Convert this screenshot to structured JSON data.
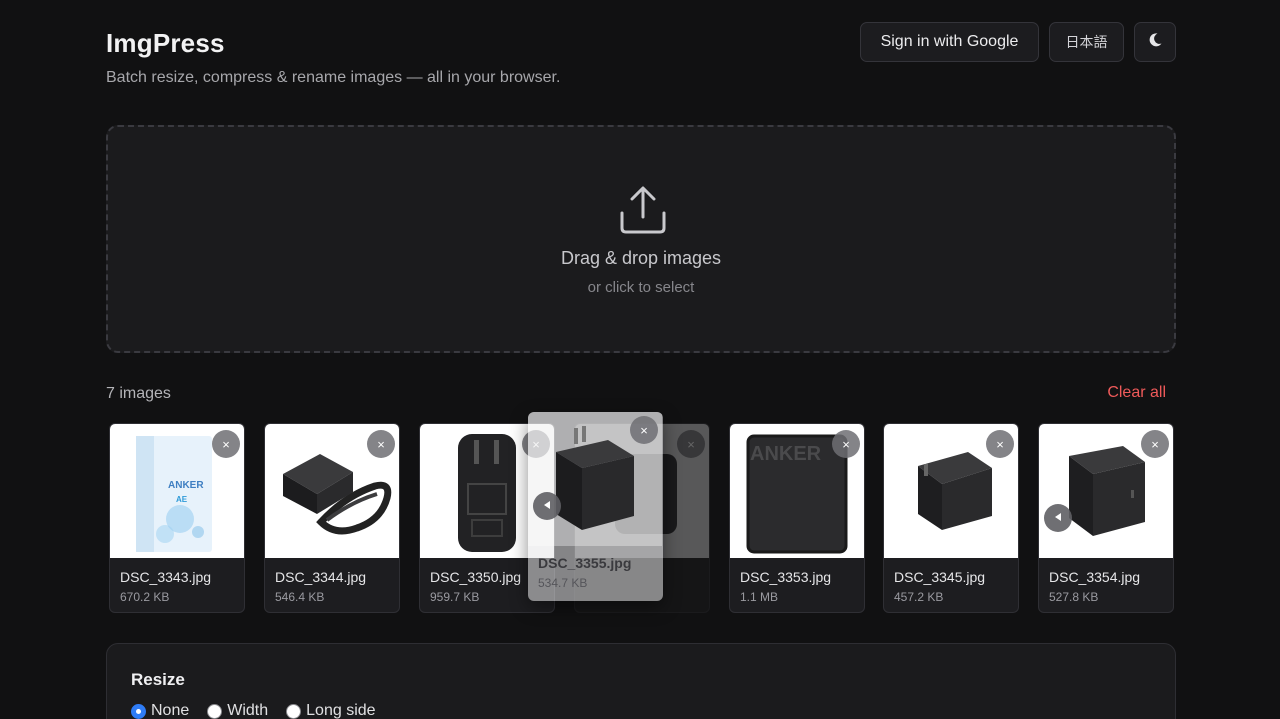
{
  "header": {
    "title": "ImgPress",
    "subtitle": "Batch resize, compress & rename images — all in your browser.",
    "sign_in_label": "Sign in with Google",
    "language_label": "日本語",
    "theme_icon": "moon-icon"
  },
  "dropzone": {
    "icon": "upload-icon",
    "title": "Drag & drop images",
    "subtitle": "or click to select"
  },
  "images": {
    "count_label": "7 images",
    "clear_label": "Clear all",
    "remove_icon": "×",
    "items": [
      {
        "name": "DSC_3343.jpg",
        "size": "670.2 KB"
      },
      {
        "name": "DSC_3344.jpg",
        "size": "546.4 KB"
      },
      {
        "name": "DSC_3350.jpg",
        "size": "959.7 KB"
      },
      {
        "name": "DSC_3355.jpg",
        "size": "534.7 KB"
      },
      {
        "name": "DSC_3353.jpg",
        "size": "1.1 MB"
      },
      {
        "name": "DSC_3345.jpg",
        "size": "457.2 KB"
      },
      {
        "name": "DSC_3354.jpg",
        "size": "527.8 KB"
      }
    ]
  },
  "resize": {
    "title": "Resize",
    "options": [
      "None",
      "Width",
      "Long side"
    ],
    "selected": "None"
  },
  "colors": {
    "accent": "#2f7cf6",
    "danger": "#ef5a5a",
    "background": "#111112"
  }
}
